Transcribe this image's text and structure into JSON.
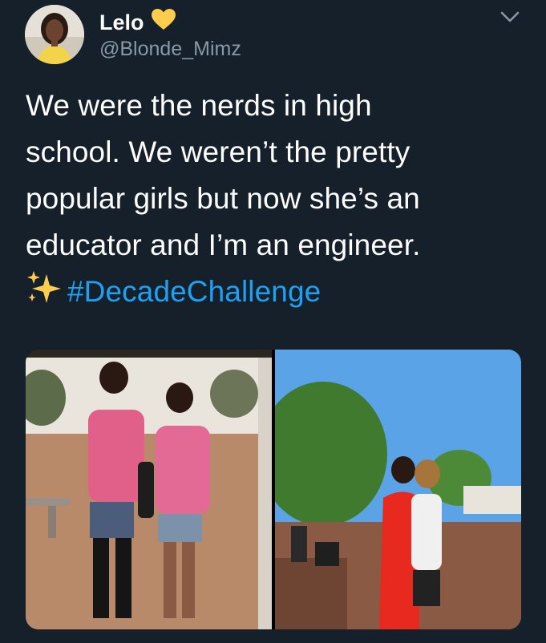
{
  "user": {
    "display_name": "Lelo",
    "handle": "@Blonde_Mimz",
    "badge_icon": "yellow-heart-icon"
  },
  "tweet": {
    "lines": [
      "We were the nerds in high",
      "school. We weren’t the pretty",
      "popular girls but now she’s an",
      "educator and I’m an engineer."
    ],
    "emoji": "sparkles-icon",
    "hashtag": "#DecadeChallenge"
  },
  "menu": {
    "icon": "chevron-down-icon"
  },
  "media": {
    "photos": [
      "then-photo",
      "now-photo"
    ]
  },
  "colors": {
    "background": "#15202b",
    "text": "#ffffff",
    "secondary_text": "#8899a6",
    "link": "#1da1f2",
    "heart": "#ffcc4d"
  }
}
